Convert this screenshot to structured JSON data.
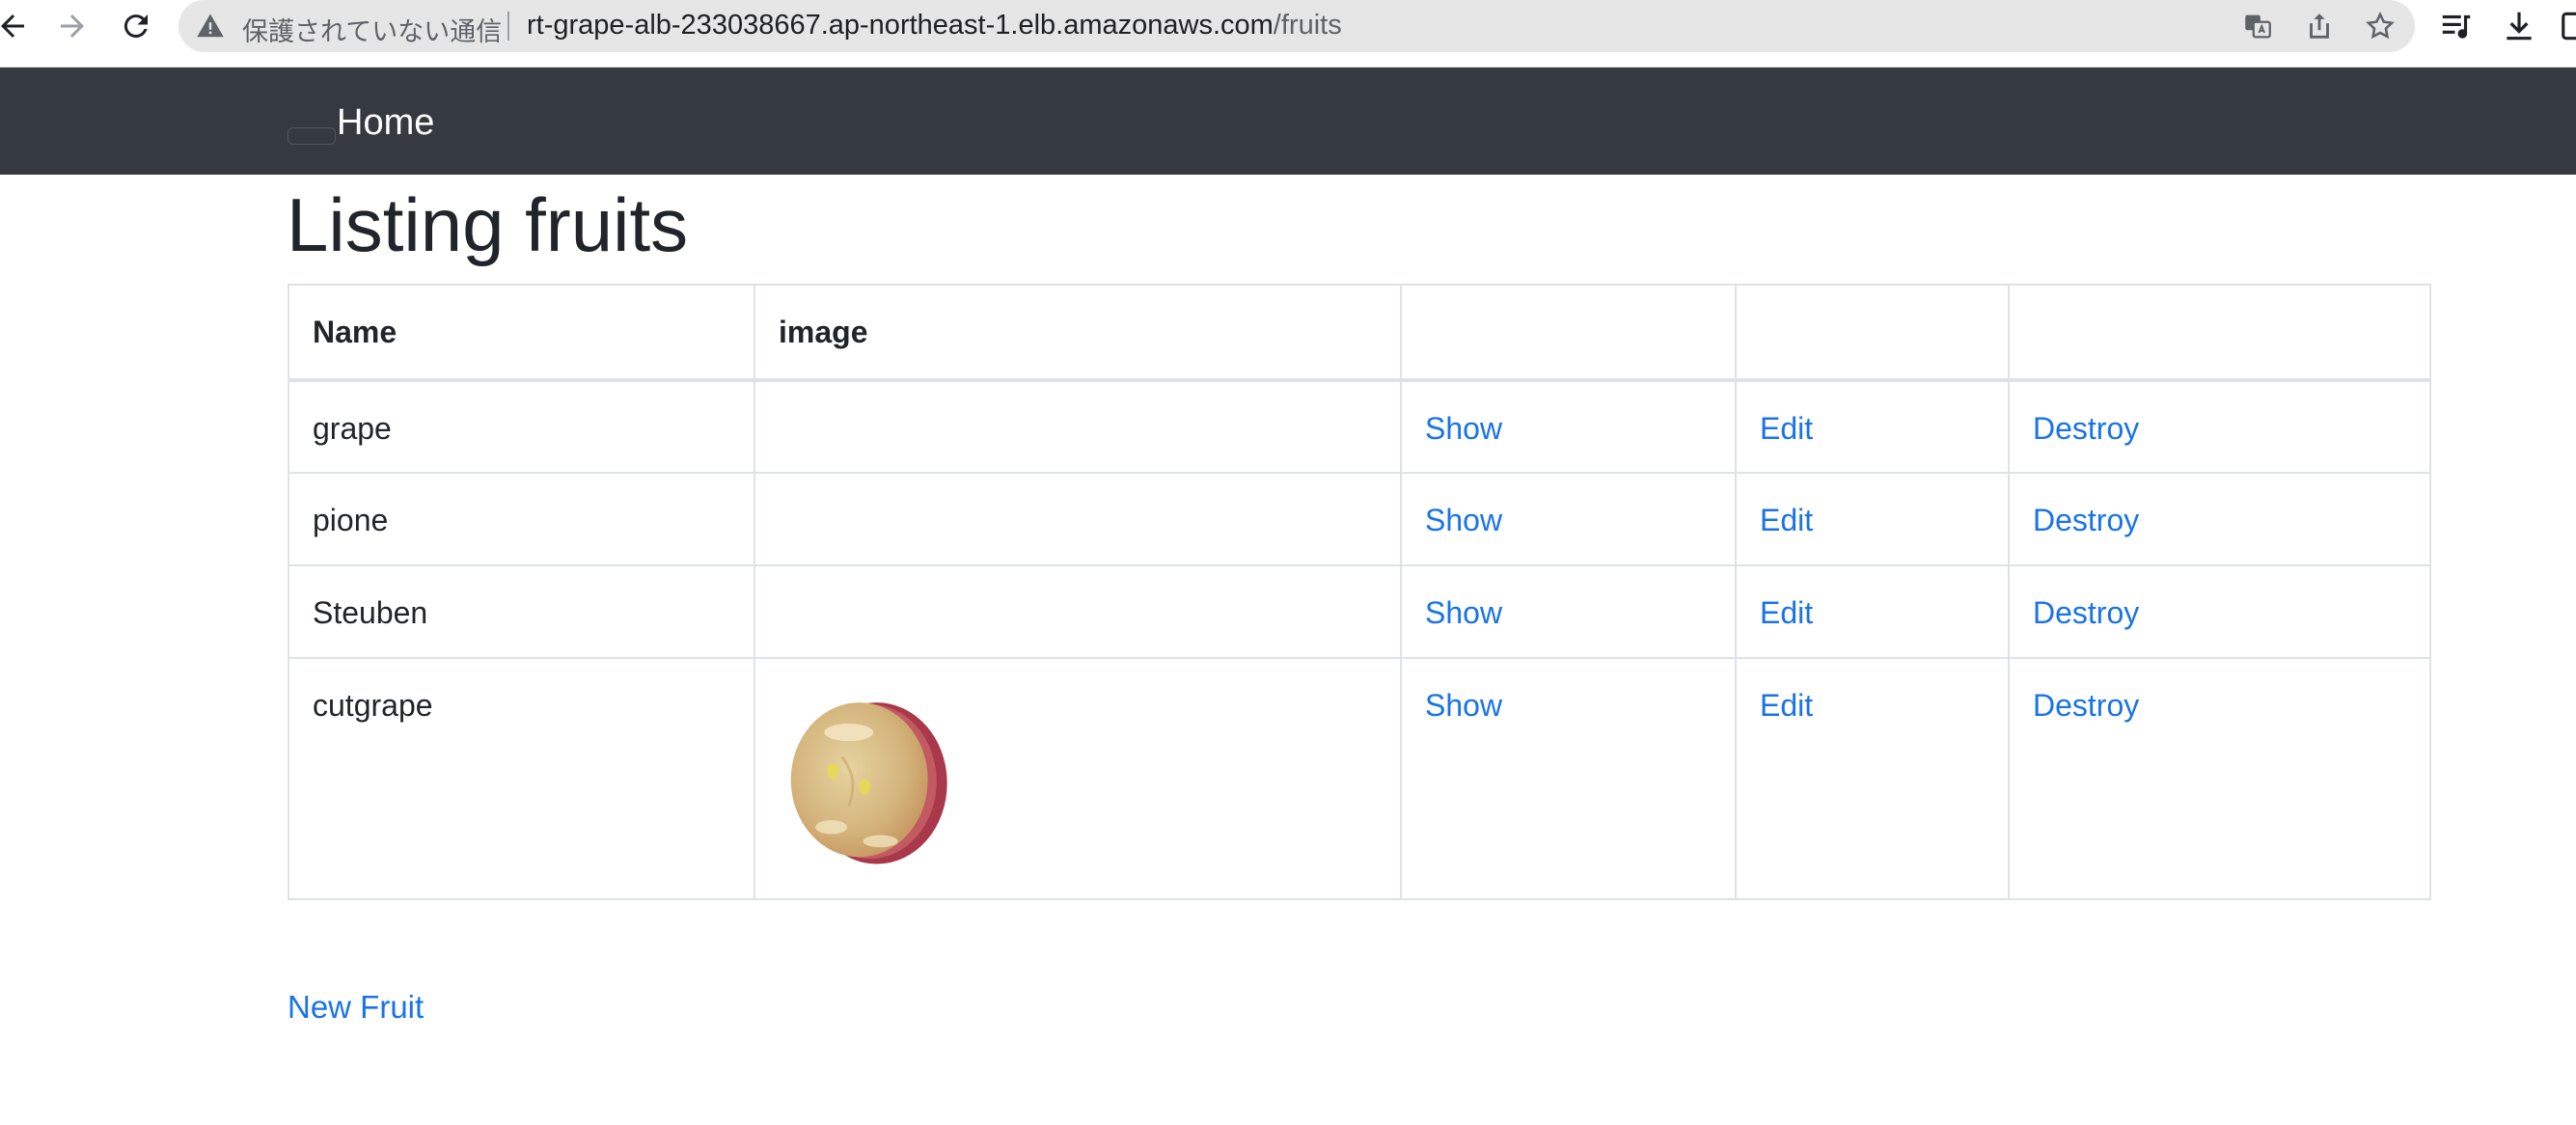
{
  "browser": {
    "security_label": "保護されていない通信",
    "url_host": "rt-grape-alb-233038667.ap-northeast-1.elb.amazonaws.com",
    "url_path": "/fruits"
  },
  "navbar": {
    "home_label": "Home"
  },
  "page": {
    "title": "Listing fruits"
  },
  "table": {
    "headers": [
      "Name",
      "image",
      "",
      "",
      ""
    ],
    "rows": [
      {
        "name": "grape",
        "has_image": false,
        "show": "Show",
        "edit": "Edit",
        "destroy": "Destroy"
      },
      {
        "name": "pione",
        "has_image": false,
        "show": "Show",
        "edit": "Edit",
        "destroy": "Destroy"
      },
      {
        "name": "Steuben",
        "has_image": false,
        "show": "Show",
        "edit": "Edit",
        "destroy": "Destroy"
      },
      {
        "name": "cutgrape",
        "has_image": true,
        "show": "Show",
        "edit": "Edit",
        "destroy": "Destroy"
      }
    ]
  },
  "actions": {
    "new_fruit": "New Fruit"
  },
  "colors": {
    "navbar_bg": "#343a40",
    "link": "#1a73e8",
    "table_border": "#dee2e6"
  }
}
